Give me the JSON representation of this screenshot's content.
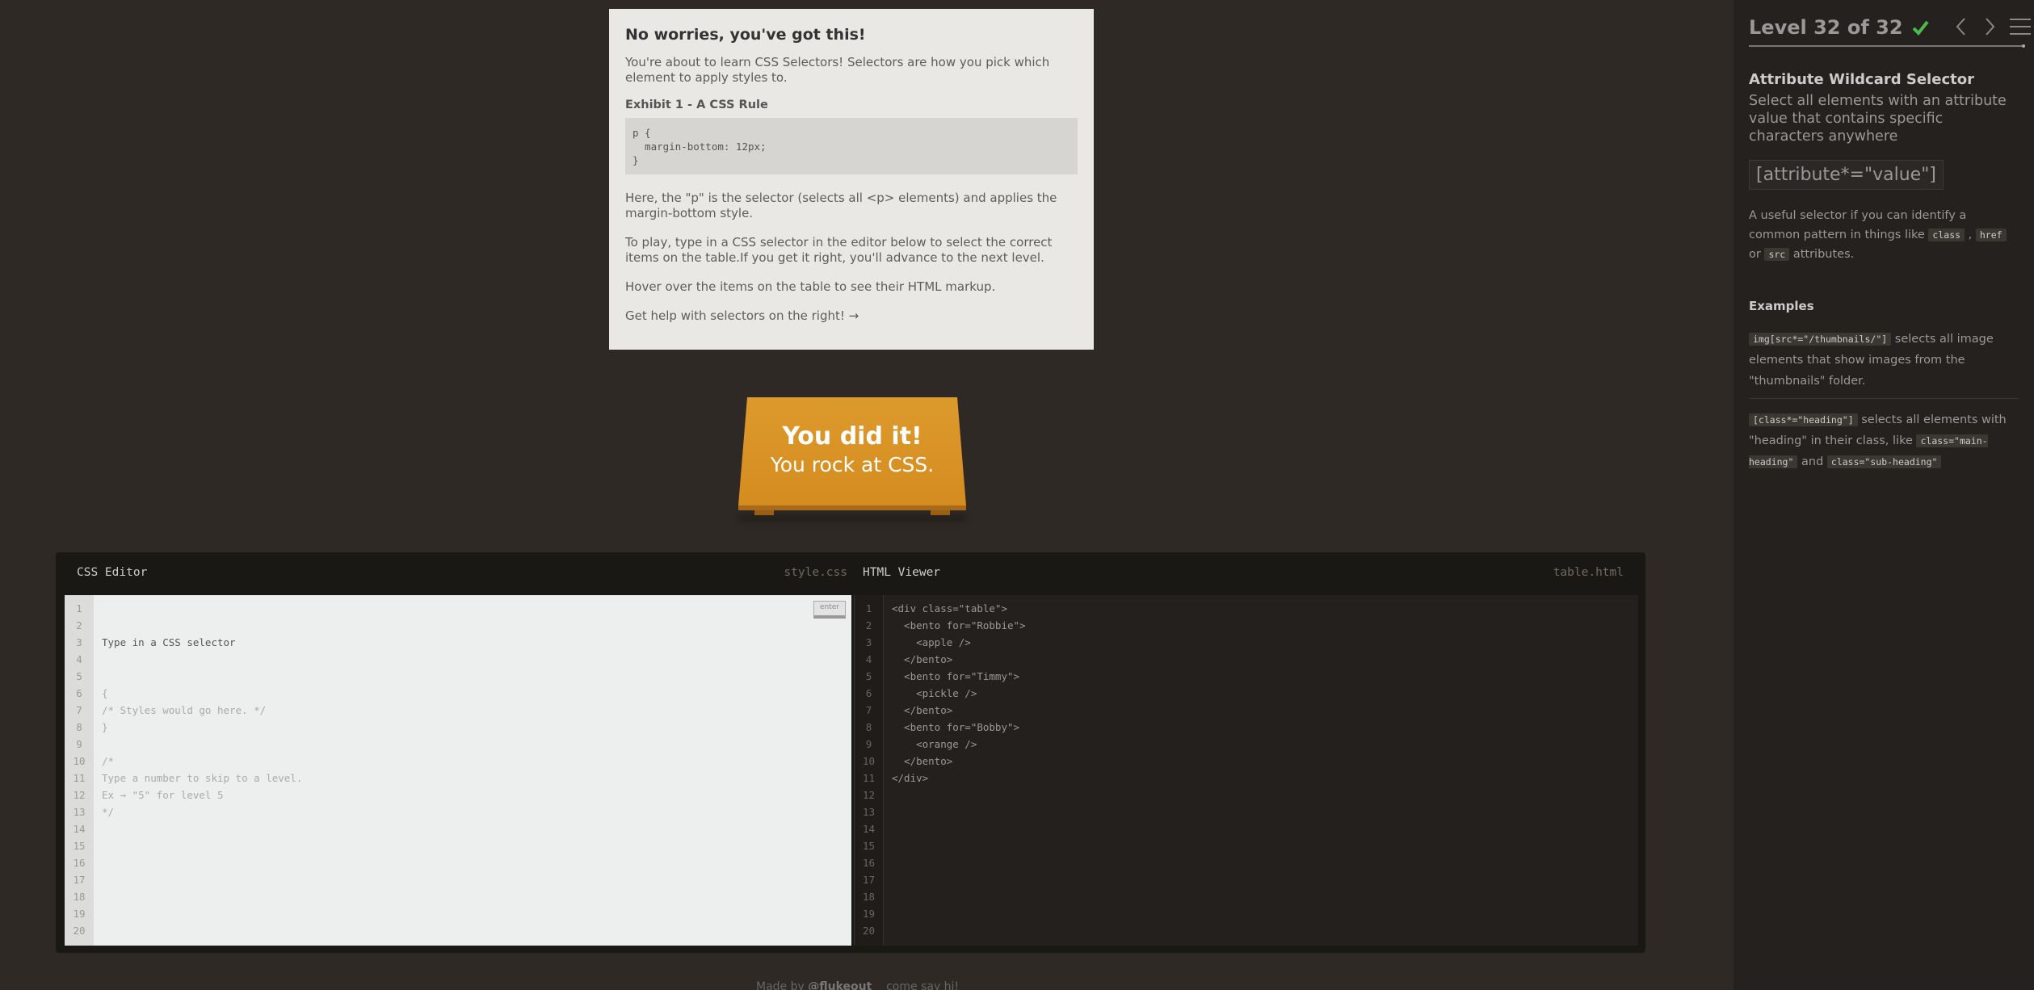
{
  "help": {
    "title": "No worries, you've got this!",
    "intro": "You're about to learn CSS Selectors! Selectors are how you pick which element to apply styles to.",
    "exhibit_title": "Exhibit 1 - A CSS Rule",
    "exhibit_code": "p {\n  margin-bottom: 12px;\n}",
    "explain": "Here, the \"p\" is the selector (selects all <p> elements) and applies the margin-bottom style.",
    "play": "To play, type in a CSS selector in the editor below to select the correct items on the table.If you get it right, you'll advance to the next level.",
    "hover": "Hover over the items on the table to see their HTML markup.",
    "help_link": "Get help with selectors on the right! →"
  },
  "win": {
    "line1": "You did it!",
    "line2": "You rock at CSS."
  },
  "editor": {
    "css_title": "CSS Editor",
    "css_file": "style.css",
    "html_title": "HTML Viewer",
    "html_file": "table.html",
    "input_placeholder": "Type in a CSS selector",
    "enter_label": "enter",
    "css_code": "{\n/* Styles would go here. */\n}\n\n/*\nType a number to skip to a level.\nEx → \"5\" for level 5\n*/",
    "html_code": "<div class=\"table\">\n  <bento for=\"Robbie\">\n    <apple />\n  </bento>\n  <bento for=\"Timmy\">\n    <pickle />\n  </bento>\n  <bento for=\"Bobby\">\n    <orange />\n  </bento>\n</div>",
    "line_count": 20
  },
  "footer": {
    "made_by": "Made by",
    "author": "@flukeout",
    "extra": "come say hi!"
  },
  "sidebar": {
    "level_label": "Level 32 of 32",
    "level_current": 32,
    "level_total": 32,
    "completed": true,
    "check_color": "#4cbb4a",
    "icons": [
      "check-icon",
      "chevron-left-icon",
      "chevron-right-icon",
      "menu-icon"
    ],
    "selector_name": "Attribute Wildcard Selector",
    "selector_desc": "Select all elements with an attribute value that contains specific characters anywhere",
    "syntax": "[attribute*=\"value\"]",
    "hint_pre": "A useful selector if you can identify a common pattern in things like",
    "hint_tags": [
      "class",
      "href",
      "src"
    ],
    "hint_or": "or",
    "hint_post": "attributes.",
    "examples_title": "Examples",
    "example1_code": "img[src*=\"/thumbnails/\"]",
    "example1_text": "selects all image elements that show images from the \"thumbnails\" folder.",
    "example2_code": "[class*=\"heading\"]",
    "example2_text": "selects all elements with \"heading\" in their class, like",
    "example2_tag1": "class=\"main-heading\"",
    "example2_and": "and",
    "example2_tag2": "class=\"sub-heading\""
  },
  "colors": {
    "background": "#2e2924",
    "sidebar": "#24211e",
    "table": "#d8911f",
    "help_bg": "#e9e8e5"
  }
}
